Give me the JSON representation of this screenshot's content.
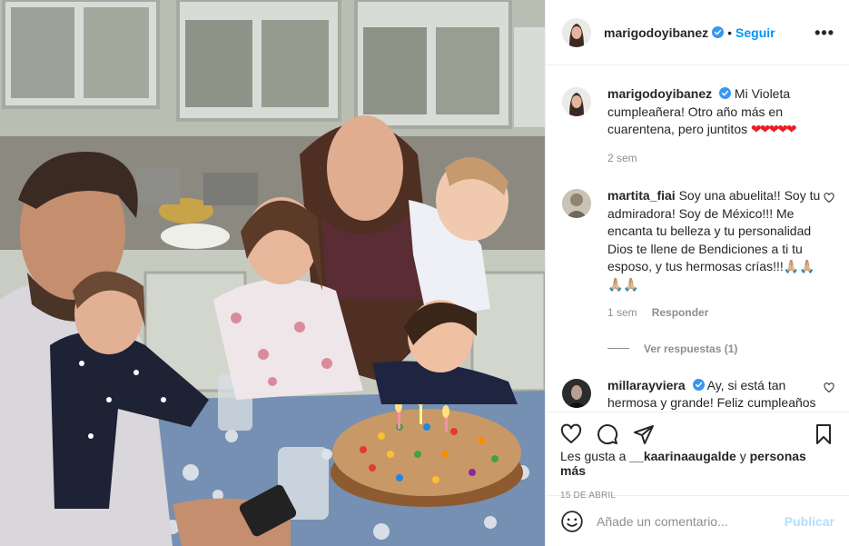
{
  "post": {
    "photo_alt": "",
    "author": {
      "username": "marigodoyibanez",
      "verified": true,
      "follow_label": "Seguir",
      "more_label": "•••"
    },
    "caption": {
      "username": "marigodoyibanez",
      "text": "Mi Violeta cumpleañera! Otro año más en cuarentena, pero juntitos",
      "emoji": "❤❤❤❤❤",
      "time": "2 sem"
    },
    "comments": [
      {
        "username": "martita_fiai",
        "text": "Soy una abuelita!! Soy tu admiradora! Soy de México!!! Me encanta tu belleza y tu personalidad Dios te llene de Bendiciones a ti tu esposo, y tus hermosas crías!!!🙏🏼🙏🏼🙏🏼🙏🏼",
        "time": "1 sem",
        "reply_label": "Responder",
        "replies_label": "Ver respuestas (1)"
      },
      {
        "username": "millarayviera",
        "verified": true,
        "text": "Ay, si está tan hermosa y grande! Feliz cumpleaños Violeta hermosa! Y"
      }
    ],
    "likes": {
      "prefix": "Les gusta a",
      "user": "__kaarinaaugalde",
      "connector": "y",
      "suffix": "personas más"
    },
    "date": "15 DE ABRIL",
    "add_comment": {
      "placeholder": "Añade un comentario...",
      "publish_label": "Publicar"
    },
    "colors": {
      "accent": "#0095f6",
      "publish_disabled": "#b2dffc",
      "heart": "#ed1c24",
      "muted": "#8e8e8e"
    }
  }
}
